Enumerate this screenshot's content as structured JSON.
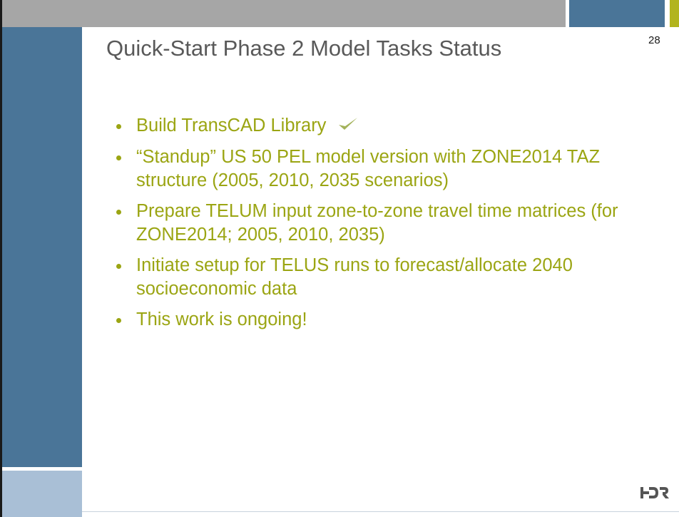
{
  "slide": {
    "title": "Quick-Start Phase 2 Model Tasks Status",
    "page_number": "28",
    "bullets": [
      {
        "text": "Build TransCAD Library",
        "check_icon": "checkmark-icon"
      },
      {
        "text": "“Standup” US 50 PEL model version with ZONE2014 TAZ structure (2005, 2010, 2035 scenarios)"
      },
      {
        "text": "Prepare TELUM input zone-to-zone travel time matrices (for ZONE2014; 2005, 2010, 2035)"
      },
      {
        "text": "Initiate setup for TELUS runs to forecast/allocate 2040 socioeconomic data"
      },
      {
        "text": "This work is ongoing!"
      }
    ],
    "logo": "HDR"
  },
  "colors": {
    "accent_text": "#9ba513",
    "band_blue": "#4a7598",
    "band_light_blue": "#a9bfd6",
    "top_gray": "#a6a6a6",
    "title_gray": "#595959"
  }
}
